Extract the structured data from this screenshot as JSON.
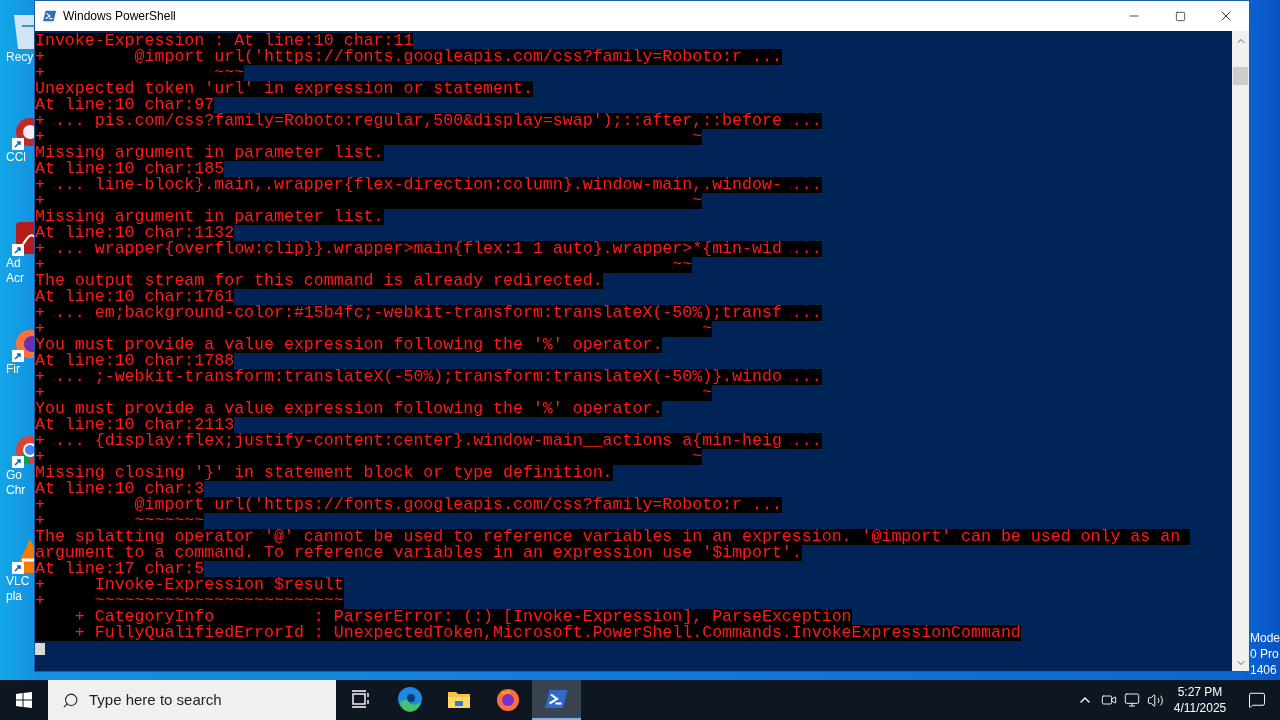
{
  "desktop": {
    "icons": [
      {
        "kind": "recycle-bin",
        "label_lines": [
          "Recy"
        ]
      },
      {
        "kind": "ccleaner",
        "label_lines": [
          "CCl"
        ]
      },
      {
        "kind": "acrobat",
        "label_lines": [
          "Ad",
          "Acr"
        ]
      },
      {
        "kind": "firefox",
        "label_lines": [
          "Fir"
        ]
      },
      {
        "kind": "chrome",
        "label_lines": [
          "Go",
          "Chr"
        ]
      },
      {
        "kind": "vlc",
        "label_lines": [
          "VLC",
          "pla"
        ]
      }
    ],
    "edge_texts": [
      "Mode",
      "0 Pro",
      "1406"
    ]
  },
  "window": {
    "title": "Windows PowerShell",
    "console_lines": [
      "Invoke-Expression : At line:10 char:11",
      "+         @import url('https://fonts.googleapis.com/css?family=Roboto:r ...",
      "+                 ~~~",
      "Unexpected token 'url' in expression or statement.",
      "At line:10 char:97",
      "+ ... pis.com/css?family=Roboto:regular,500&display=swap');::after,::before ...",
      "+                                                                 ~",
      "Missing argument in parameter list.",
      "At line:10 char:185",
      "+ ... line-block}.main,.wrapper{flex-direction:column}.window-main,.window- ...",
      "+                                                                 ~",
      "Missing argument in parameter list.",
      "At line:10 char:1132",
      "+ ... wrapper{overflow:clip}}.wrapper>main{flex:1 1 auto}.wrapper>*{min-wid ...",
      "+                                                               ~~",
      "The output stream for this command is already redirected.",
      "At line:10 char:1761",
      "+ ... em;background-color:#15b4fc;-webkit-transform:translateX(-50%);transf ...",
      "+                                                                  ~",
      "You must provide a value expression following the '%' operator.",
      "At line:10 char:1788",
      "+ ... ;-webkit-transform:translateX(-50%);transform:translateX(-50%)}.windo ...",
      "+                                                                  ~",
      "You must provide a value expression following the '%' operator.",
      "At line:10 char:2113",
      "+ ... {display:flex;justify-content:center}.window-main__actions a{min-heig ...",
      "+                                                                 ~",
      "Missing closing '}' in statement block or type definition.",
      "At line:10 char:3",
      "+         @import url('https://fonts.googleapis.com/css?family=Roboto:r ...",
      "+         ~~~~~~~",
      "The splatting operator '@' cannot be used to reference variables in an expression. '@import' can be used only as an ",
      "argument to a command. To reference variables in an expression use '$import'.",
      "At line:17 char:5",
      "+     Invoke-Expression $result",
      "+     ~~~~~~~~~~~~~~~~~~~~~~~~~",
      "    + CategoryInfo          : ParserError: (:) [Invoke-Expression], ParseException",
      "    + FullyQualifiedErrorId : UnexpectedToken,Microsoft.PowerShell.Commands.InvokeExpressionCommand"
    ]
  },
  "taskbar": {
    "search": {
      "placeholder": "Type here to search"
    },
    "apps": [
      {
        "kind": "task-view",
        "selected": false
      },
      {
        "kind": "edge",
        "selected": false
      },
      {
        "kind": "explorer",
        "selected": false
      },
      {
        "kind": "firefox",
        "selected": false
      },
      {
        "kind": "powershell",
        "selected": true
      }
    ],
    "clock": {
      "time": "5:27 PM",
      "date": "4/11/2025"
    }
  }
}
